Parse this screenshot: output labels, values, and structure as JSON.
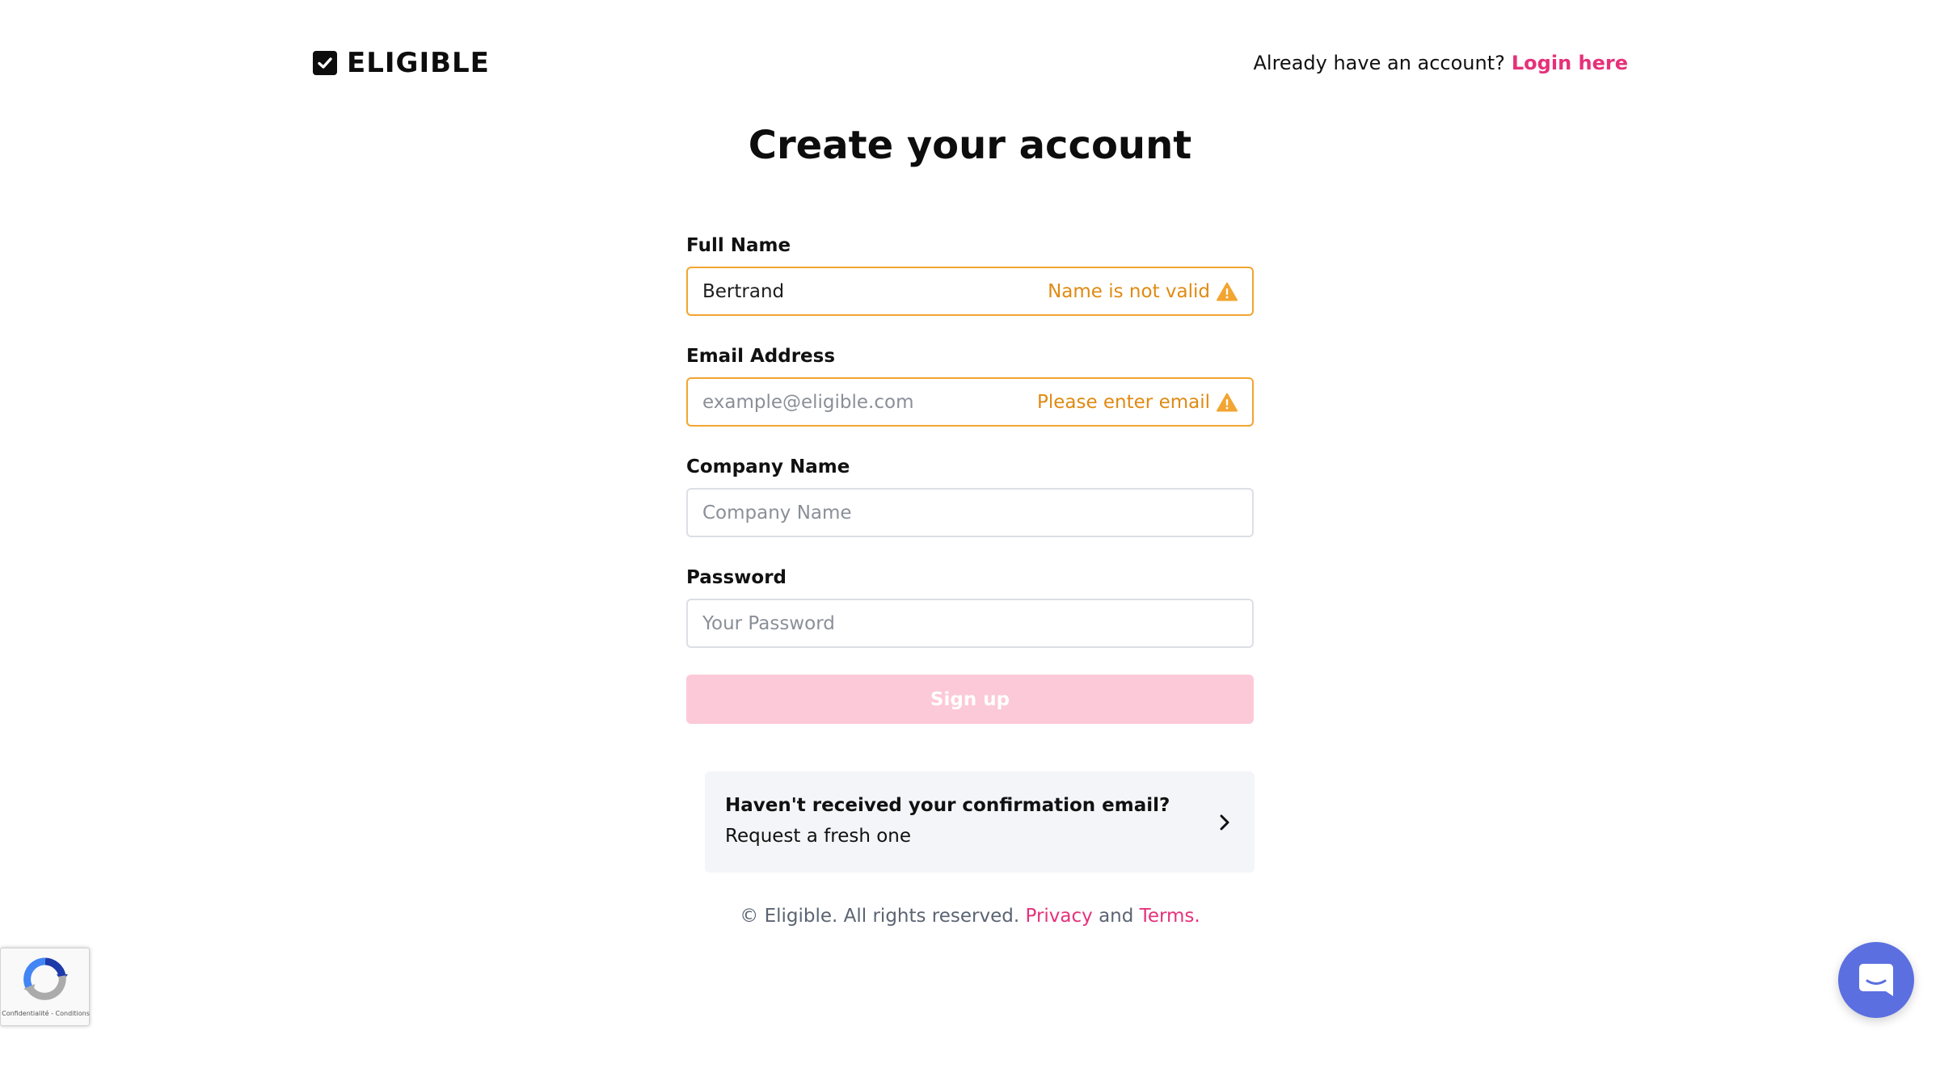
{
  "brand": {
    "name": "ELIGIBLE",
    "icon": "checkbox-check-icon"
  },
  "header": {
    "login_prompt": "Already have an account?",
    "login_link": "Login here"
  },
  "page_title": "Create your account",
  "form": {
    "full_name": {
      "label": "Full Name",
      "value": "Bertrand",
      "placeholder": "",
      "error": "Name is not valid"
    },
    "email": {
      "label": "Email Address",
      "value": "",
      "placeholder": "example@eligible.com",
      "error": "Please enter email"
    },
    "company": {
      "label": "Company Name",
      "value": "",
      "placeholder": "Company Name"
    },
    "password": {
      "label": "Password",
      "value": "",
      "placeholder": "Your Password"
    },
    "submit_label": "Sign up"
  },
  "confirmation": {
    "title": "Haven't received your confirmation email?",
    "subtitle": "Request a fresh one"
  },
  "footer": {
    "copyright": "© Eligible. All rights reserved.",
    "privacy": "Privacy",
    "and": "and",
    "terms": "Terms",
    "period": "."
  },
  "recaptcha": {
    "links": "Confidentialité - Conditions"
  },
  "colors": {
    "accent": "#e6317a",
    "error": "#e08a12",
    "error_border": "#f2a531",
    "button_disabled": "#fcc9d8",
    "chat": "#5b6fe0"
  }
}
